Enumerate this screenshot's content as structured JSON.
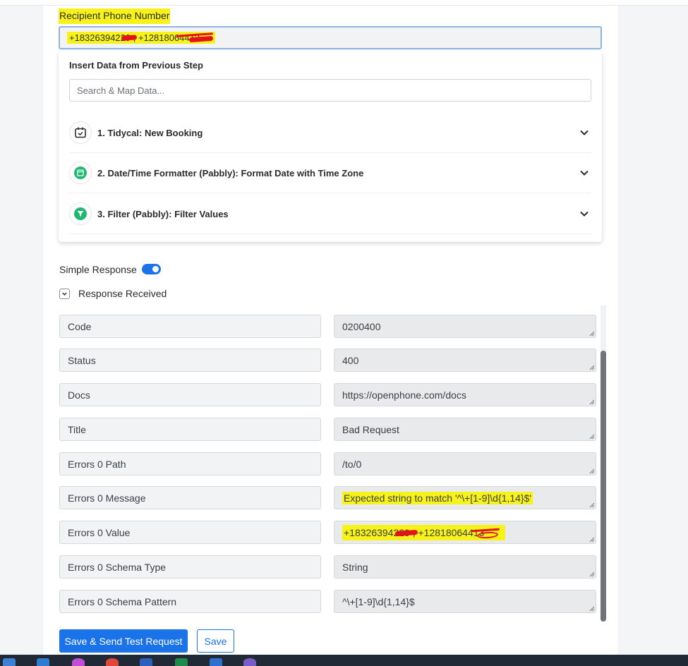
{
  "form": {
    "recipient_label": "Recipient Phone Number",
    "recipient_value": "+18326394229 , +12818064413"
  },
  "insert_data": {
    "title": "Insert Data from Previous Step",
    "search_placeholder": "Search & Map Data...",
    "steps": [
      {
        "label": "1. Tidycal: New Booking",
        "icon": "calendar-icon"
      },
      {
        "label": "2. Date/Time Formatter (Pabbly): Format Date with Time Zone",
        "icon": "date-formatter-icon"
      },
      {
        "label": "3. Filter (Pabbly): Filter Values",
        "icon": "filter-icon"
      }
    ]
  },
  "simple_response": {
    "label": "Simple Response",
    "enabled": true
  },
  "response_received": {
    "label": "Response Received",
    "expanded": true
  },
  "response_rows": [
    {
      "key": "Code",
      "value": "0200400"
    },
    {
      "key": "Status",
      "value": "400"
    },
    {
      "key": "Docs",
      "value": "https://openphone.com/docs"
    },
    {
      "key": "Title",
      "value": "Bad Request"
    },
    {
      "key": "Errors 0 Path",
      "value": "/to/0"
    },
    {
      "key": "Errors 0 Message",
      "value": "Expected string to match '^\\+[1-9]\\d{1,14}$'"
    },
    {
      "key": "Errors 0 Value",
      "value": "+18326394229 , +12818064413"
    },
    {
      "key": "Errors 0 Schema Type",
      "value": "String"
    },
    {
      "key": "Errors 0 Schema Pattern",
      "value": "^\\+[1-9]\\d{1,14}$"
    }
  ],
  "buttons": {
    "save_send": "Save & Send Test Request",
    "save": "Save"
  },
  "colors": {
    "primary": "#1a73e8",
    "highlight": "#f7f21a",
    "step_icon_green": "#1fb871"
  }
}
